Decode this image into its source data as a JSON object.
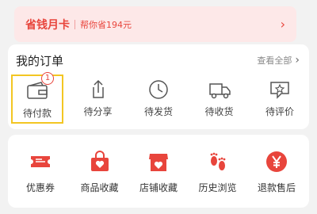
{
  "banner": {
    "title": "省钱月卡",
    "subtitle": "帮你省194元",
    "arrow": "›"
  },
  "orders": {
    "title": "我的订单",
    "view_all": "查看全部",
    "arrow": "›",
    "items": [
      {
        "label": "待付款",
        "icon": "wallet-icon",
        "badge": "1",
        "selected": true
      },
      {
        "label": "待分享",
        "icon": "share-icon"
      },
      {
        "label": "待发货",
        "icon": "clock-icon"
      },
      {
        "label": "待收货",
        "icon": "truck-icon"
      },
      {
        "label": "待评价",
        "icon": "review-icon"
      }
    ]
  },
  "services": {
    "items": [
      {
        "label": "优惠券",
        "icon": "coupon-icon"
      },
      {
        "label": "商品收藏",
        "icon": "bag-heart-icon"
      },
      {
        "label": "店铺收藏",
        "icon": "shop-heart-icon"
      },
      {
        "label": "历史浏览",
        "icon": "footprints-icon"
      },
      {
        "label": "退款售后",
        "icon": "yen-icon"
      }
    ]
  },
  "colors": {
    "accent_red": "#e8453c",
    "banner_bg": "#fde8e8",
    "selected_outline": "#f3c623",
    "page_bg": "#f2f2f2"
  }
}
